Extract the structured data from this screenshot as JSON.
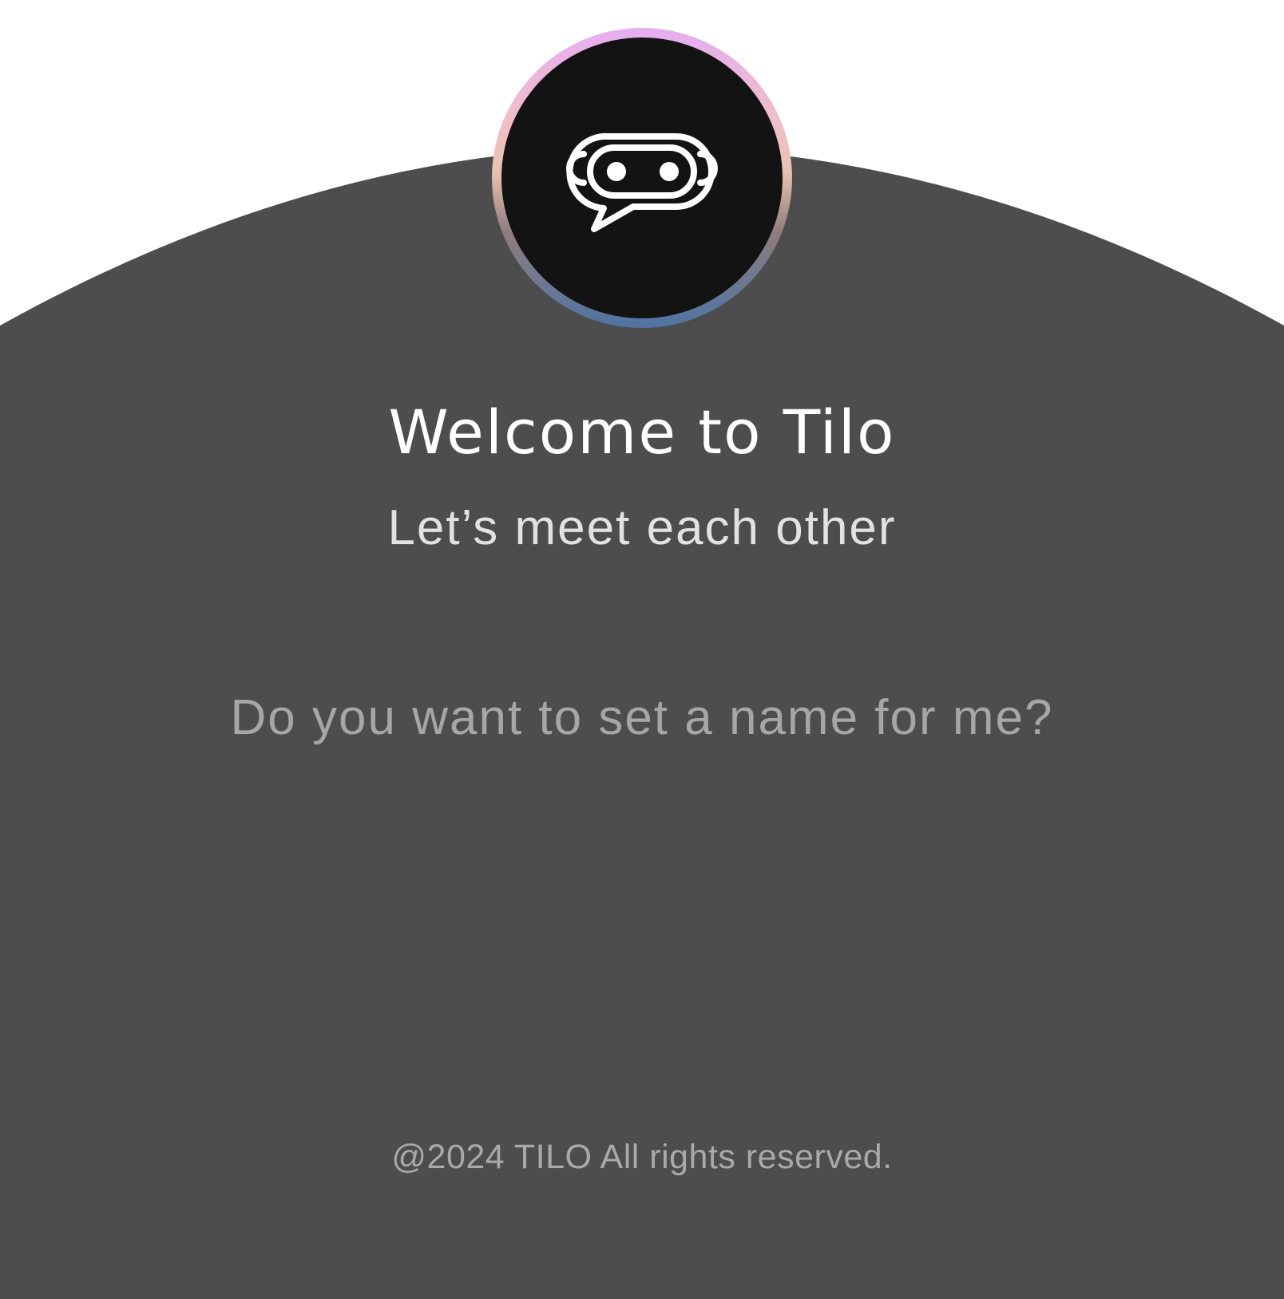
{
  "colors": {
    "background": "#ffffff",
    "panel": "#4d4d4d",
    "avatar_bg": "#131313",
    "avatar_ring_top": "#e6adf2",
    "avatar_ring_bottom": "#4f74a3",
    "title": "#ffffff",
    "subtitle": "#e2e2e2",
    "question": "#a6a6a6",
    "footer": "#a9a9a9"
  },
  "avatar": {
    "icon": "chat-bot-icon"
  },
  "welcome": {
    "title": "Welcome to Tilo",
    "subtitle": "Let’s meet each other"
  },
  "prompt": {
    "question": "Do you want to set a name for me?"
  },
  "footer": {
    "copyright": "@2024 TILO All rights reserved."
  }
}
